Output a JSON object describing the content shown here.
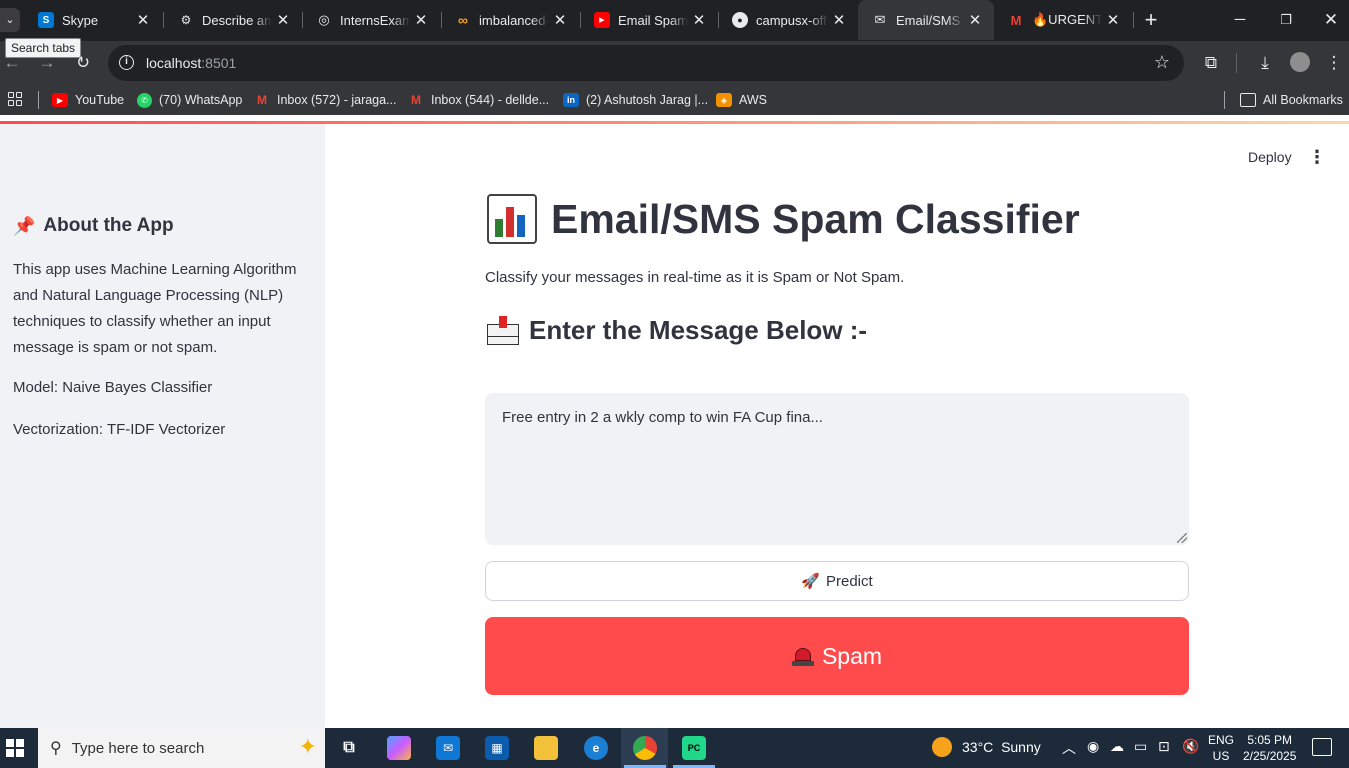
{
  "browser": {
    "tabs": [
      {
        "title": "Skype",
        "icon": "skype-icon",
        "color": "#0078d4"
      },
      {
        "title": "Describe and",
        "icon": "chatgpt-icon",
        "color": "#202124"
      },
      {
        "title": "InternsExam",
        "icon": "globe-icon",
        "color": "#202124"
      },
      {
        "title": "imbalanced-",
        "icon": "kaggle-icon",
        "color": "#f7a21b"
      },
      {
        "title": "Email Spam",
        "icon": "youtube-icon",
        "color": "#ff0000"
      },
      {
        "title": "campusx-off",
        "icon": "github-icon",
        "color": "#202124"
      },
      {
        "title": "Email/SMS S",
        "icon": "envelope-icon",
        "color": "#e8eaed",
        "active": true
      },
      {
        "title": "🔥URGENT: S",
        "icon": "gmail-icon",
        "color": "#ea4335"
      }
    ],
    "tooltip": "Search tabs",
    "url_host": "localhost",
    "url_port": ":8501",
    "bookmarks": [
      {
        "label": "YouTube",
        "icon": "youtube-icon"
      },
      {
        "label": "(70) WhatsApp",
        "icon": "whatsapp-icon"
      },
      {
        "label": "Inbox (572) - jaraga...",
        "icon": "gmail-icon"
      },
      {
        "label": "Inbox (544) - dellde...",
        "icon": "gmail-icon"
      },
      {
        "label": "(2) Ashutosh Jarag |...",
        "icon": "linkedin-icon"
      },
      {
        "label": "AWS",
        "icon": "aws-icon"
      }
    ],
    "all_bookmarks": "All Bookmarks"
  },
  "sidebar": {
    "heading": "About the App",
    "description": "This app uses Machine Learning Algorithm and Natural Language Processing (NLP) techniques to classify whether an input message is spam or not spam.",
    "model": "Model: Naive Bayes Classifier",
    "vectorizer": "Vectorization: TF-IDF Vectorizer"
  },
  "header": {
    "deploy_label": "Deploy"
  },
  "main": {
    "title": "Email/SMS Spam Classifier",
    "subtitle": "Classify your messages in real-time as it is Spam or Not Spam.",
    "input_heading": "Enter the Message Below :-",
    "message_value": "Free entry in 2 a wkly comp to win FA Cup fina...",
    "predict_label": "Predict",
    "result_label": "Spam",
    "result_color": "#ff4b4b"
  },
  "taskbar": {
    "search_placeholder": "Type here to search",
    "weather_temp": "33°C",
    "weather_desc": "Sunny",
    "lang_line1": "ENG",
    "lang_line2": "US",
    "time": "5:05 PM",
    "date": "2/25/2025"
  }
}
